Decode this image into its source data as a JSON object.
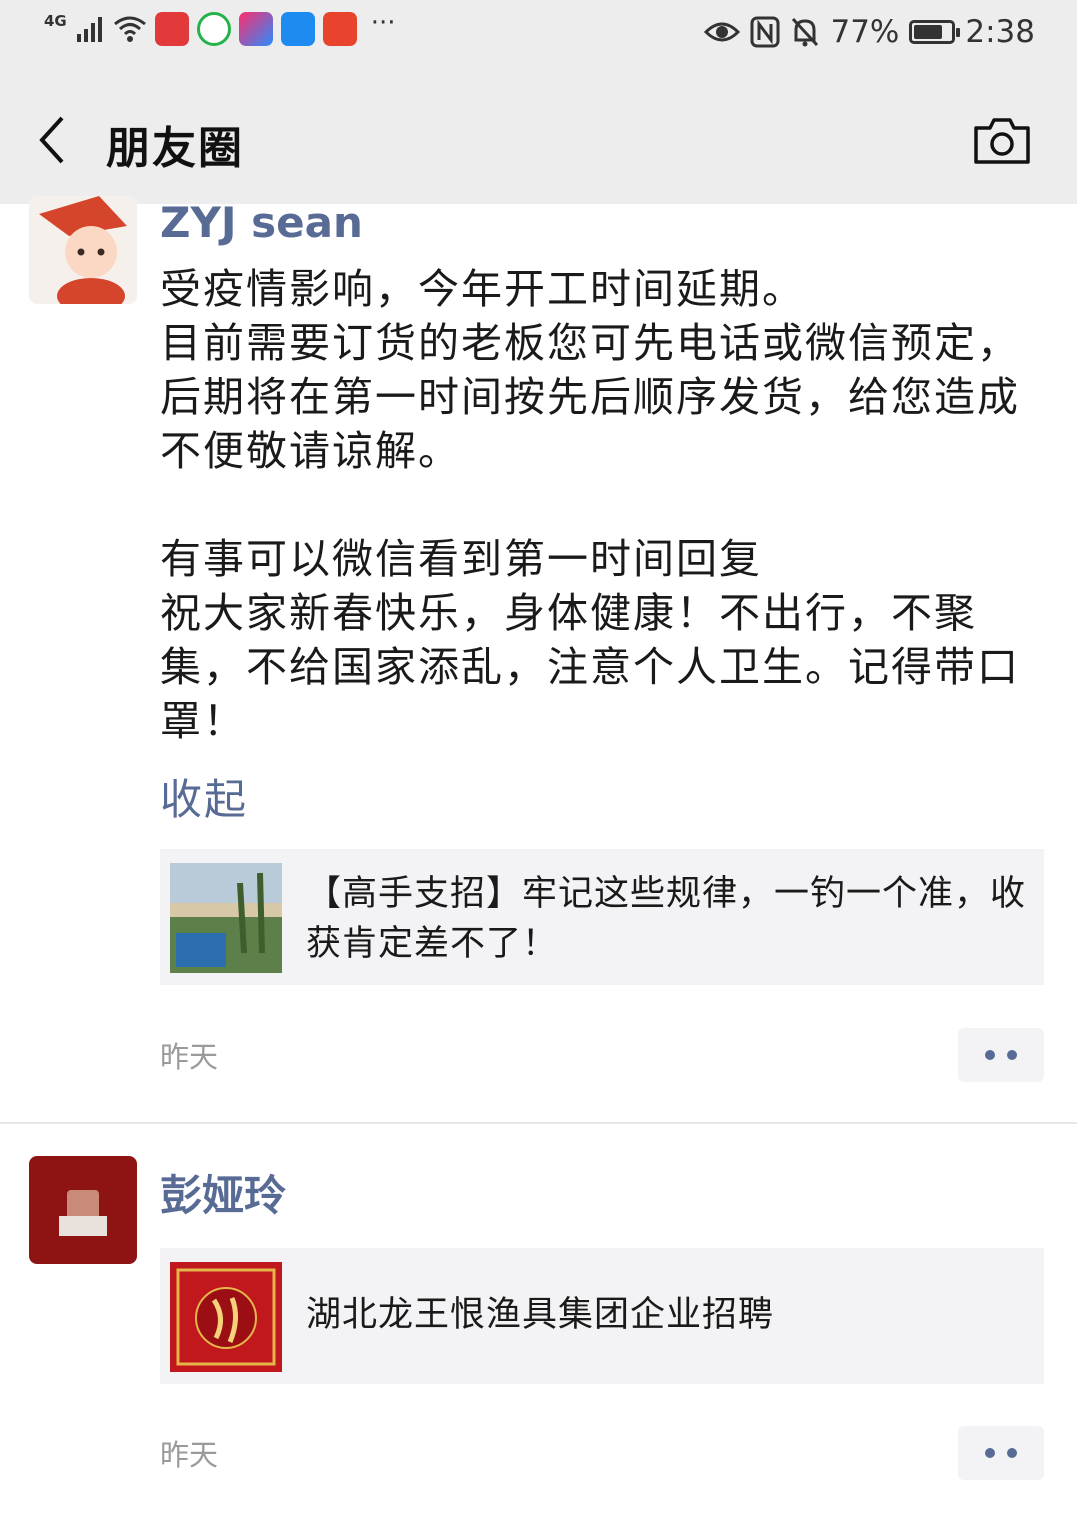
{
  "status_bar": {
    "network": "4G",
    "battery_percent": "77%",
    "battery_level": 0.77,
    "time": "2:38",
    "more": "···",
    "apps": [
      {
        "icon": "recorder-icon",
        "color": "#e23a3a"
      },
      {
        "icon": "video-icon",
        "color": "#24b24a"
      },
      {
        "icon": "music-icon",
        "color": "#f2f2f2"
      },
      {
        "icon": "alipay-icon",
        "color": "#1e8bf0"
      },
      {
        "icon": "shrimp-icon",
        "color": "#e8432d"
      }
    ]
  },
  "nav": {
    "title": "朋友圈",
    "back_icon": "chevron-left-icon",
    "camera_icon": "camera-icon"
  },
  "posts": [
    {
      "name": "ZYJ  sean",
      "text": "受疫情影响，今年开工时间延期。\n目前需要订货的老板您可先电话或微信预定，后期将在第一时间按先后顺序发货，给您造成不便敬请谅解。\n\n有事可以微信看到第一时间回复\n祝大家新春快乐，身体健康！不出行，不聚集，不给国家添乱，注意个人卫生。记得带口罩！",
      "collapse": "收起",
      "link_title": "【高手支招】牢记这些规律，一钓一个准，收获肯定差不了！",
      "time": "昨天"
    },
    {
      "name": "彭娅玲",
      "link_title": "湖北龙王恨渔具集团企业招聘",
      "time": "昨天"
    }
  ],
  "colors": {
    "link_blue": "#576b95",
    "header_bg": "#ededed",
    "card_bg": "#f3f3f5"
  }
}
